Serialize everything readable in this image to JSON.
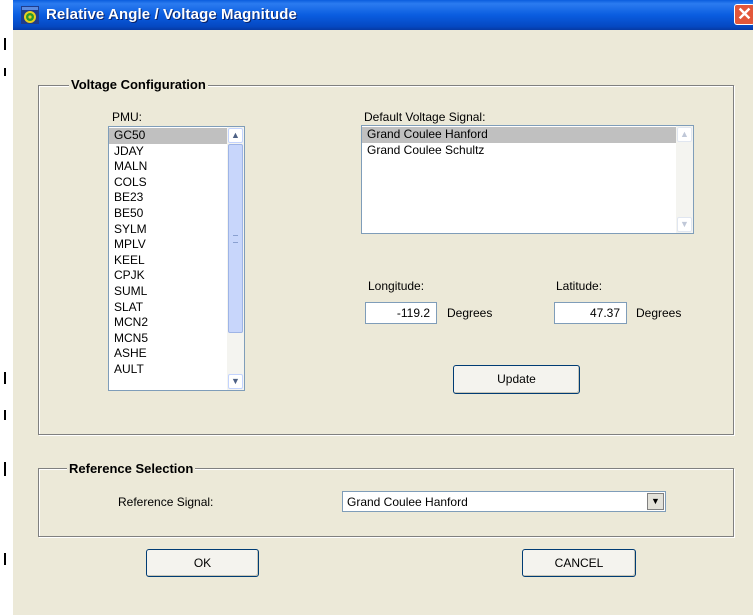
{
  "window": {
    "title": "Relative Angle / Voltage Magnitude",
    "close_glyph": "✕"
  },
  "voltage_config": {
    "legend": "Voltage Configuration",
    "pmu_label": "PMU:",
    "pmu_items": [
      "GC50",
      "JDAY",
      "MALN",
      "COLS",
      "BE23",
      "BE50",
      "SYLM",
      "MPLV",
      "KEEL",
      "CPJK",
      "SUML",
      "SLAT",
      "MCN2",
      "MCN5",
      "ASHE",
      "AULT"
    ],
    "pmu_selected": "GC50",
    "signal_label": "Default Voltage Signal:",
    "signal_items": [
      "Grand Coulee Hanford",
      "Grand Coulee Schultz"
    ],
    "signal_selected": "Grand Coulee Hanford",
    "longitude_label": "Longitude:",
    "longitude_value": "-119.2",
    "longitude_unit": "Degrees",
    "latitude_label": "Latitude:",
    "latitude_value": "47.37",
    "latitude_unit": "Degrees",
    "update_label": "Update"
  },
  "reference": {
    "legend": "Reference Selection",
    "signal_label": "Reference Signal:",
    "signal_value": "Grand Coulee Hanford"
  },
  "buttons": {
    "ok": "OK",
    "cancel": "CANCEL"
  },
  "icons": {
    "app": "app-icon",
    "close": "close-icon",
    "scroll_up": "scroll-up-arrow-icon",
    "scroll_down": "scroll-down-arrow-icon",
    "dropdown": "dropdown-arrow-icon"
  },
  "colors": {
    "titlebar": "#0a5de0",
    "dialog_bg": "#ece9d8",
    "close_button": "#e2573a",
    "selection": "#c0c0c0"
  }
}
